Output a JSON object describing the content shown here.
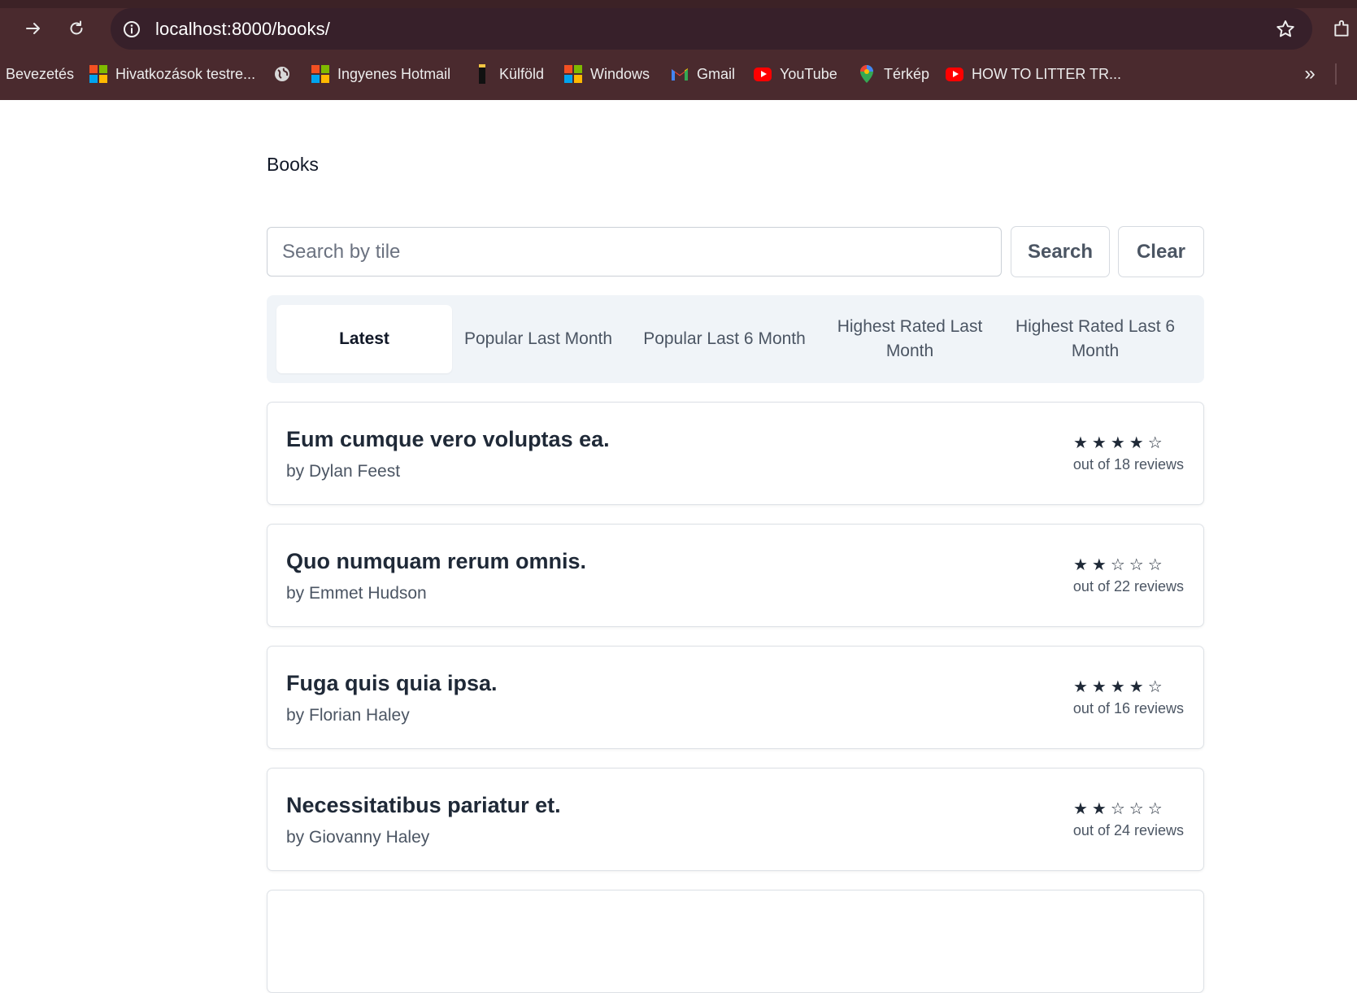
{
  "browser": {
    "url": "localhost:8000/books/",
    "bookmarks": [
      {
        "label": "Bevezetés",
        "icon": "none"
      },
      {
        "label": "Hivatkozások testre...",
        "icon": "microsoft-logo-icon"
      },
      {
        "label": "",
        "icon": "globe-icon"
      },
      {
        "label": "Ingyenes Hotmail",
        "icon": "microsoft-logo-icon"
      },
      {
        "label": "Külföld",
        "icon": "bookmark-folder-icon"
      },
      {
        "label": "Windows",
        "icon": "microsoft-logo-icon"
      },
      {
        "label": "Gmail",
        "icon": "gmail-icon"
      },
      {
        "label": "YouTube",
        "icon": "youtube-icon"
      },
      {
        "label": "Térkép",
        "icon": "maps-pin-icon"
      },
      {
        "label": "HOW TO LITTER TR...",
        "icon": "youtube-icon"
      }
    ],
    "more_bookmarks": "»"
  },
  "page": {
    "title": "Books",
    "search": {
      "placeholder": "Search by tile",
      "value": "",
      "search_label": "Search",
      "clear_label": "Clear"
    },
    "tabs": [
      {
        "label": "Latest",
        "active": true
      },
      {
        "label": "Popular Last Month",
        "active": false
      },
      {
        "label": "Popular Last 6 Month",
        "active": false
      },
      {
        "label": "Highest Rated Last Month",
        "active": false
      },
      {
        "label": "Highest Rated Last 6 Month",
        "active": false
      }
    ],
    "books": [
      {
        "title": "Eum cumque vero voluptas ea.",
        "author": "by Dylan Feest",
        "stars": "★★★★☆",
        "rating_filled": 4,
        "reviews": "out of 18 reviews"
      },
      {
        "title": "Quo numquam rerum omnis.",
        "author": "by Emmet Hudson",
        "stars": "★★☆☆☆",
        "rating_filled": 2,
        "reviews": "out of 22 reviews"
      },
      {
        "title": "Fuga quis quia ipsa.",
        "author": "by Florian Haley",
        "stars": "★★★★☆",
        "rating_filled": 4,
        "reviews": "out of 16 reviews"
      },
      {
        "title": "Necessitatibus pariatur et.",
        "author": "by Giovanny Haley",
        "stars": "★★☆☆☆",
        "rating_filled": 2,
        "reviews": "out of 24 reviews"
      }
    ]
  },
  "colors": {
    "chrome_bg": "#4a2a2e",
    "omnibox_bg": "#37202a",
    "tab_strip_bg": "#f0f4f8",
    "text_dark": "#1f2937",
    "text_muted": "#4b5563"
  }
}
